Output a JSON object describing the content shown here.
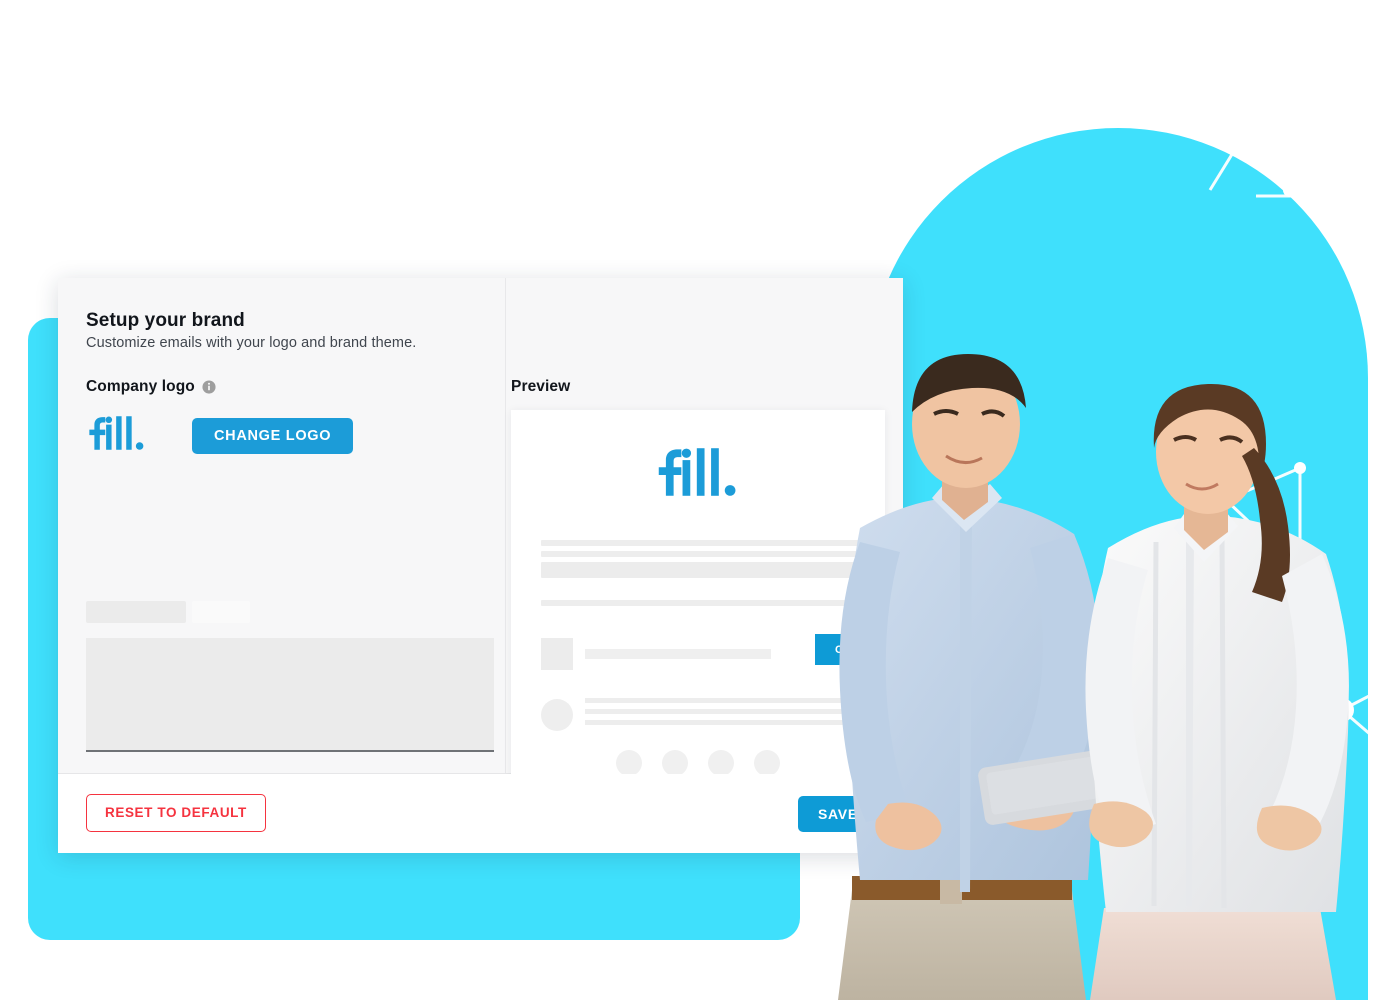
{
  "card": {
    "title": "Setup your brand",
    "subtitle": "Customize emails with your logo and brand theme.",
    "left_column": {
      "field_label": "Company logo",
      "info_icon": "info-icon",
      "logo_text": "fill.",
      "change_logo_label": "CHANGE LOGO"
    },
    "right_column": {
      "preview_label": "Preview",
      "preview_logo_text": "fill.",
      "preview_button_label": "C"
    },
    "footer": {
      "reset_label": "RESET TO DEFAULT",
      "save_label": "SAVE"
    }
  },
  "decor": {
    "handshake_icon": "handshake-with-stars-icon",
    "star_count": 3,
    "network_icon": "network-nodes-pattern",
    "arch_icon": "cyan-arch-shape",
    "plate_icon": "cyan-offset-plate",
    "photo": "two-people-looking-at-tablet-photo"
  },
  "colors": {
    "cyan": "#3FE0FC",
    "brand_blue": "#1C9CD8",
    "preview_blue": "#0E9BD6",
    "danger_red": "#F5333F",
    "panel_bg": "#F7F7F8",
    "skeleton": "#EBEBEB"
  }
}
